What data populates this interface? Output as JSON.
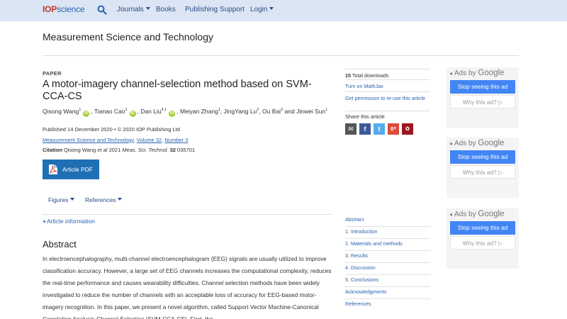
{
  "nav": {
    "logo_iop": "IOP",
    "logo_science": "science",
    "journals": "Journals",
    "books": "Books",
    "publishing_support": "Publishing Support",
    "login": "Login"
  },
  "journal_title": "Measurement Science and Technology",
  "article": {
    "type": "PAPER",
    "title": "A motor-imagery channel-selection method based on SVM-CCA-CS",
    "authors": [
      {
        "name": "Qisong Wang",
        "sup": "1",
        "orcid": true
      },
      {
        "name": "Tianao Cao",
        "sup": "1",
        "orcid": true
      },
      {
        "name": "Dan Liu",
        "sup": "4,1",
        "orcid": true
      },
      {
        "name": "Meiyan Zhang",
        "sup": "1",
        "orcid": false
      },
      {
        "name": "JingYang Lu",
        "sup": "2",
        "orcid": false
      },
      {
        "name": "Ou Bai",
        "sup": "3",
        "orcid": false
      },
      {
        "name": "Jinwei Sun",
        "sup": "1",
        "orcid": false
      }
    ],
    "and_word": "and",
    "published": "Published 14 December 2020 • © 2020 IOP Publishing Ltd",
    "journal_link": "Measurement Science and Technology",
    "volume_link": "Volume 32",
    "number_link": "Number 3",
    "citation_label": "Citation",
    "citation_authors": "Qisong Wang",
    "citation_etal": "et al",
    "citation_year": "2021",
    "citation_journal": "Meas. Sci. Technol.",
    "citation_volume": "32",
    "citation_number": "035701"
  },
  "pdf_button": "Article PDF",
  "tabs": {
    "figures": "Figures",
    "references": "References"
  },
  "article_info": "Article information",
  "abstract": {
    "heading": "Abstract",
    "text": "In electroencephalography, multi-channel electroencephalogram (EEG) signals are usually utilized to improve classification accuracy. However, a large set of EEG channels increases the computational complexity, reduces the real-time performance and causes wearability difficulties. Channel selection methods have been widely investigated to reduce the number of channels with an acceptable loss of accuracy for EEG-based motor-imagery recognition. In this paper, we present a novel algorithm, called Support Vector Machine-Canonical Correlation Analysis-Channel Selection (SVM-CCA-CS). First, the"
  },
  "sidebar": {
    "downloads_count": "15",
    "downloads_label": "Total downloads",
    "mathjax": "Turn on MathJax",
    "permission": "Get permission to re-use this article",
    "share_label": "Share this article",
    "share_icons": [
      "email-icon",
      "facebook-icon",
      "twitter-icon",
      "google-plus-icon",
      "mendeley-icon"
    ],
    "share_colors": [
      "#555555",
      "#3b5998",
      "#55acee",
      "#dd4b39",
      "#9d1620"
    ],
    "toc": [
      "Abstract",
      "1. Introduction",
      "2. Materials and methods",
      "3. Results",
      "4. Discussion",
      "5. Conclusions",
      "Acknowledgments",
      "References"
    ]
  },
  "ads": {
    "ads_by": "Ads by",
    "google": "Google",
    "stop": "Stop seeing this ad",
    "why": "Why this ad?"
  }
}
